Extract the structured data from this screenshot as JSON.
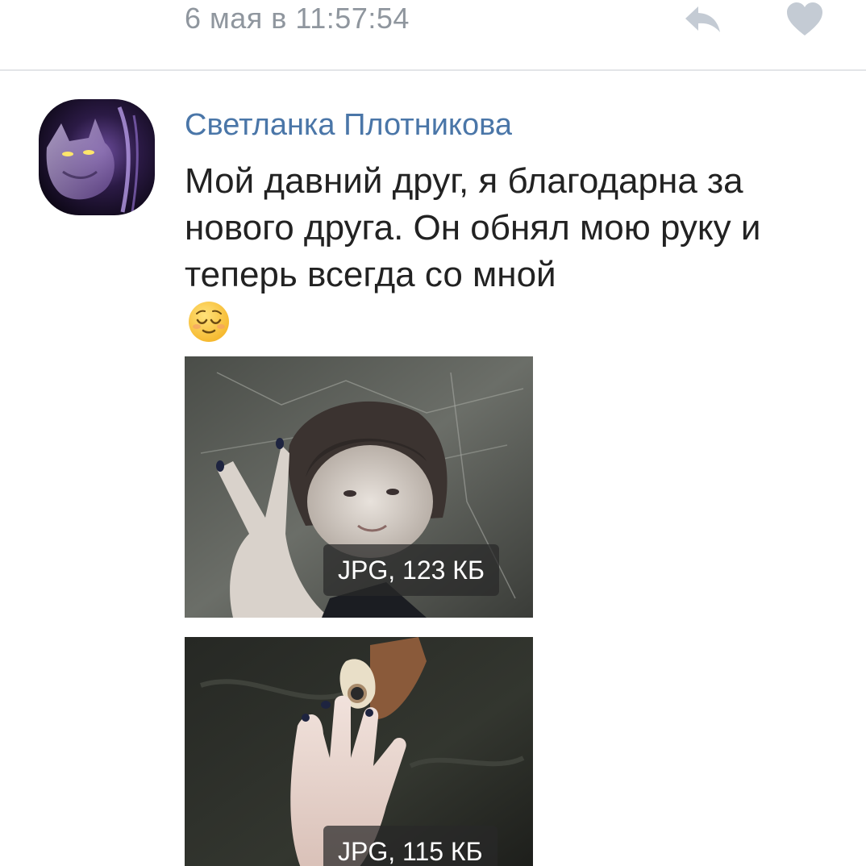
{
  "post": {
    "timestamp": "6 мая в 11:57:54",
    "actions": {
      "reply_icon": "reply-arrow-icon",
      "like_icon": "heart-icon"
    }
  },
  "comment": {
    "author": "Светланка Плотникова",
    "avatar_icon": "wolf-avatar",
    "text": "Мой давний друг, я благодарна за нового друга. Он обнял мою руку и теперь всегда со мной",
    "emoji": "relieved-face-emoji",
    "attachments": [
      {
        "type": "image",
        "badge": "JPG, 123 КБ"
      },
      {
        "type": "image",
        "badge": "JPG, 115 КБ"
      }
    ]
  },
  "colors": {
    "link": "#4a76a8",
    "meta": "#8f969e",
    "icon": "#c4cbd4",
    "text": "#222222"
  }
}
